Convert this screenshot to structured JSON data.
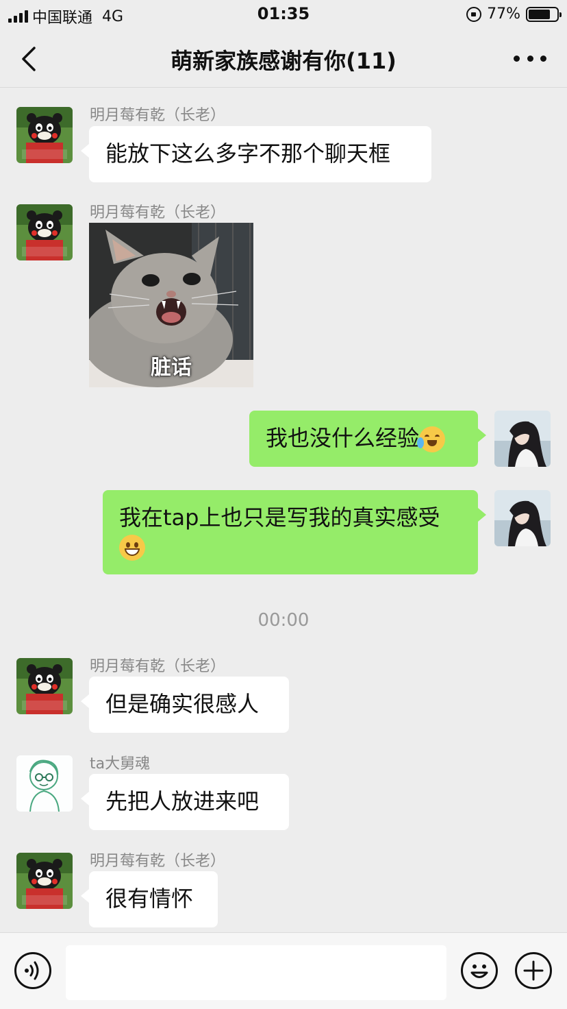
{
  "status_bar": {
    "carrier": "中国联通",
    "network": "4G",
    "time": "01:35",
    "battery": "77%",
    "battery_level": 0.77
  },
  "header": {
    "title": "萌新家族感谢有你(11)",
    "back_icon": "chevron-left-icon",
    "more_icon": "more-dots-icon"
  },
  "messages": [
    {
      "side": "in",
      "sender": "明月莓有乾（长老）",
      "text": "能放下这么多字不那个聊天框"
    },
    {
      "side": "in",
      "sender": "明月莓有乾（长老）",
      "sticker_caption": "脏话"
    },
    {
      "side": "out",
      "text": "我也没什么经验",
      "emoji": "crying-laughing"
    },
    {
      "side": "out",
      "text": "我在tap上也只是写我的真实感受",
      "emoji": "grinning"
    },
    {
      "side": "in",
      "sender": "明月莓有乾（长老）",
      "text": "但是确实很感人"
    },
    {
      "side": "in",
      "sender": "ta大舅魂",
      "text": "先把人放进来吧"
    },
    {
      "side": "in",
      "sender": "明月莓有乾（长老）",
      "text": "很有情怀"
    }
  ],
  "time_separator": "00:00",
  "input_bar": {
    "voice_icon": "voice-icon",
    "emoji_icon": "smiley-icon",
    "plus_icon": "plus-icon",
    "value": ""
  },
  "colors": {
    "background": "#ededed",
    "outgoing_bubble": "#95ec69",
    "incoming_bubble": "#ffffff"
  }
}
